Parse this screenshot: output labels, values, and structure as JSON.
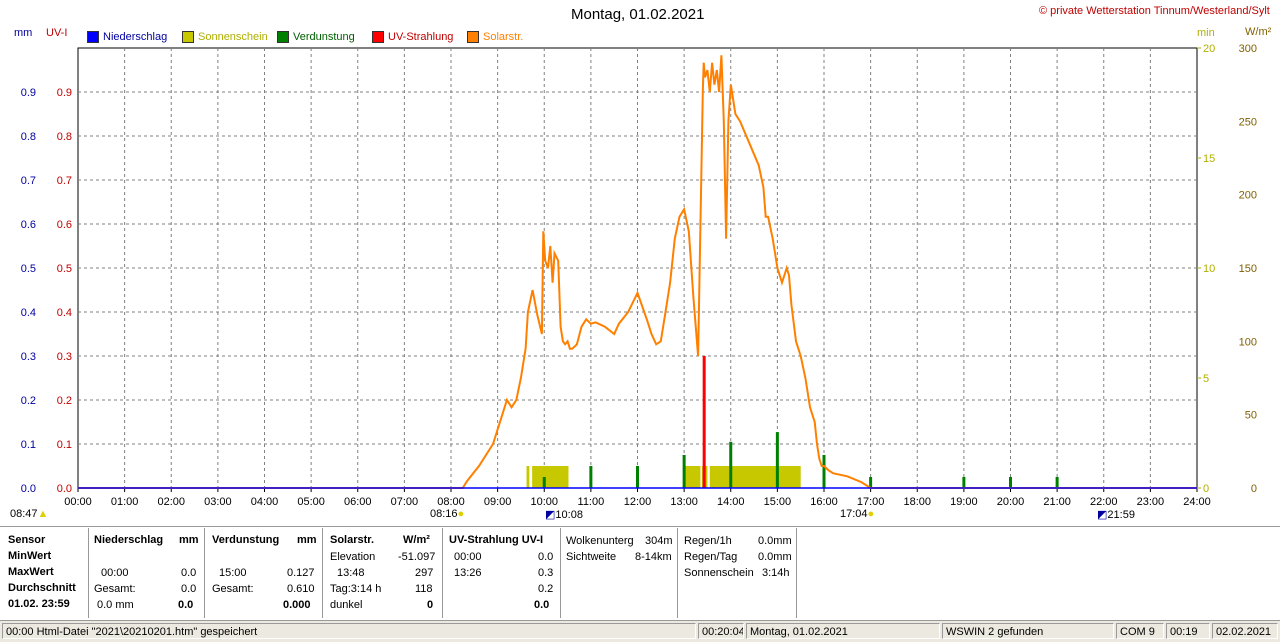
{
  "header": {
    "title": "Montag, 01.02.2021",
    "copyright": "© private Wetterstation Tinnum/Westerland/Sylt",
    "left_unit_mm": "mm",
    "left_unit_uv": "UV-I",
    "right_unit_min": "min",
    "right_unit_wm2": "W/m²"
  },
  "legend": [
    {
      "label": "Niederschlag",
      "color": "#0000ff"
    },
    {
      "label": "Sonnenschein",
      "color": "#c8c800"
    },
    {
      "label": "Verdunstung",
      "color": "#008000"
    },
    {
      "label": "UV-Strahlung",
      "color": "#ff0000"
    },
    {
      "label": "Solarstr.",
      "color": "#ff8000"
    }
  ],
  "colors": {
    "left_axis": "#0000a0",
    "uv_axis": "#c00000",
    "min_axis": "#b0b000",
    "wm2_axis": "#806000",
    "solar": "#ff8000",
    "uv": "#ff0000",
    "evap": "#008000",
    "sun": "#c8c800",
    "rain": "#0000ff"
  },
  "chart_data": {
    "type": "line",
    "title": "Montag, 01.02.2021",
    "x_ticks": [
      "00:00",
      "01:00",
      "02:00",
      "03:00",
      "04:00",
      "05:00",
      "06:00",
      "07:00",
      "08:00",
      "09:00",
      "10:00",
      "11:00",
      "12:00",
      "13:00",
      "14:00",
      "15:00",
      "16:00",
      "17:00",
      "18:00",
      "19:00",
      "20:00",
      "21:00",
      "22:00",
      "23:00",
      "24:00"
    ],
    "xlim_hours": [
      0,
      24
    ],
    "y_left": {
      "unit": "mm / UV-I",
      "ylim": [
        0,
        1.0
      ],
      "ticks": [
        "0.0",
        "0.1",
        "0.2",
        "0.3",
        "0.4",
        "0.5",
        "0.6",
        "0.7",
        "0.8",
        "0.9"
      ]
    },
    "y_right_min": {
      "unit": "min",
      "ylim": [
        0,
        20
      ],
      "ticks": [
        "0",
        "5",
        "10",
        "15",
        "20"
      ]
    },
    "y_right_wm2": {
      "unit": "W/m²",
      "ylim": [
        0,
        300
      ],
      "ticks": [
        "0",
        "50",
        "100",
        "150",
        "200",
        "250",
        "300"
      ]
    },
    "grid": true,
    "series": [
      {
        "name": "Solarstr.",
        "axis": "wm2",
        "kind": "line",
        "x": [
          0,
          8.25,
          8.35,
          8.6,
          8.9,
          9.1,
          9.2,
          9.3,
          9.4,
          9.5,
          9.6,
          9.65,
          9.75,
          9.85,
          9.95,
          9.98,
          10.02,
          10.08,
          10.13,
          10.18,
          10.22,
          10.3,
          10.35,
          10.4,
          10.45,
          10.5,
          10.55,
          10.6,
          10.7,
          10.8,
          10.9,
          11.0,
          11.1,
          11.3,
          11.5,
          11.6,
          11.8,
          12.0,
          12.2,
          12.3,
          12.4,
          12.5,
          12.6,
          12.7,
          12.8,
          12.9,
          13.0,
          13.1,
          13.2,
          13.3,
          13.4,
          13.42,
          13.45,
          13.5,
          13.55,
          13.6,
          13.65,
          13.7,
          13.75,
          13.8,
          13.85,
          13.9,
          13.95,
          14.0,
          14.1,
          14.2,
          14.4,
          14.6,
          14.7,
          14.75,
          14.8,
          14.9,
          15.0,
          15.05,
          15.1,
          15.2,
          15.25,
          15.3,
          15.4,
          15.5,
          15.6,
          15.7,
          15.8,
          15.85,
          15.9,
          15.95,
          16.0,
          16.1,
          16.2,
          16.5,
          16.8,
          17.0,
          24.0
        ],
        "values": [
          0,
          0,
          5,
          15,
          30,
          50,
          60,
          55,
          60,
          75,
          95,
          120,
          135,
          118,
          105,
          175,
          155,
          150,
          165,
          140,
          160,
          155,
          110,
          100,
          98,
          100,
          95,
          95,
          98,
          110,
          115,
          112,
          113,
          110,
          105,
          112,
          120,
          133,
          115,
          105,
          98,
          100,
          120,
          140,
          170,
          185,
          190,
          175,
          130,
          90,
          270,
          290,
          280,
          285,
          270,
          290,
          275,
          285,
          270,
          295,
          250,
          170,
          250,
          275,
          255,
          250,
          235,
          220,
          205,
          185,
          185,
          170,
          150,
          145,
          140,
          150,
          145,
          125,
          100,
          90,
          75,
          55,
          45,
          30,
          20,
          15,
          15,
          12,
          10,
          8,
          4,
          0,
          0
        ]
      },
      {
        "name": "UV-Strahlung",
        "axis": "left",
        "kind": "bars",
        "x": [
          13.43
        ],
        "values": [
          0.3
        ]
      },
      {
        "name": "Verdunstung",
        "axis": "left",
        "kind": "bars",
        "x": [
          10.0,
          11.0,
          12.0,
          13.0,
          14.0,
          15.0,
          16.0,
          17.0,
          19.0,
          20.0,
          21.0
        ],
        "values": [
          0.025,
          0.05,
          0.05,
          0.075,
          0.105,
          0.127,
          0.075,
          0.025,
          0.025,
          0.025,
          0.025
        ]
      },
      {
        "name": "Sonnenschein",
        "axis": "min",
        "kind": "blocks",
        "x": [
          9.62,
          9.74,
          13.0,
          13.38,
          13.55
        ],
        "x_end": [
          9.68,
          10.52,
          13.35,
          13.5,
          15.5
        ],
        "values": [
          1.0,
          1.0,
          1.0,
          1.0,
          1.0
        ]
      },
      {
        "name": "Niederschlag",
        "axis": "left",
        "kind": "line",
        "x": [
          0,
          24
        ],
        "values": [
          0,
          0
        ]
      }
    ],
    "markers": [
      {
        "label": "08:47",
        "icon": "moon-icon"
      },
      {
        "label": "08:16",
        "icon": "sunrise-icon"
      },
      {
        "label": "10:08",
        "icon": "moon-icon"
      },
      {
        "label": "17:04",
        "icon": "sunset-icon"
      },
      {
        "label": "21:59",
        "icon": "moon-icon"
      }
    ]
  },
  "panels": {
    "sensor": {
      "h": "Sensor",
      "r1": "MinWert",
      "r2": "MaxWert",
      "r3": "Durchschnitt",
      "r4": "01.02. 23:59"
    },
    "rain": {
      "h": "Niederschlag",
      "u": "mm",
      "max_time": "00:00",
      "max_val": "0.0",
      "total_lbl": "Gesamt:",
      "total_val": "0.0",
      "avg_lbl": "0.0 mm",
      "avg_val": "0.0"
    },
    "evap": {
      "h": "Verdunstung",
      "u": "mm",
      "max_time": "15:00",
      "max_val": "0.127",
      "total_lbl": "Gesamt:",
      "total_val": "0.610",
      "avg_val": "0.000"
    },
    "solar": {
      "h": "Solarstr.",
      "u": "W/m²",
      "elev_lbl": "Elevation",
      "elev_val": "-51.097",
      "max_time": "13:48",
      "max_val": "297",
      "day_lbl": "Tag:3:14 h",
      "day_val": "118",
      "dark_lbl": "dunkel",
      "dark_val": "0"
    },
    "uv": {
      "h": "UV-Strahlung UV-I",
      "min_time": "00:00",
      "min_val": "0.0",
      "max_time": "13:26",
      "max_val": "0.3",
      "avg_val": "0.2",
      "end_val": "0.0"
    },
    "cloud": {
      "l1": "Wolkenunterg",
      "v1": "304m",
      "l2": "Sichtweite",
      "v2": "8-14km"
    },
    "rainh": {
      "l1": "Regen/1h",
      "v1": "0.0mm",
      "l2": "Regen/Tag",
      "v2": "0.0mm",
      "l3": "Sonnenschein",
      "v3": "3:14h"
    }
  },
  "status": {
    "c1": "00:00  Html-Datei  \"2021\\20210201.htm\"  gespeichert",
    "c2": "00:20:04",
    "c3": "Montag, 01.02.2021",
    "c4": "WSWIN 2 gefunden",
    "c5": "COM 9",
    "c6": "00:19",
    "c7": "02.02.2021"
  }
}
